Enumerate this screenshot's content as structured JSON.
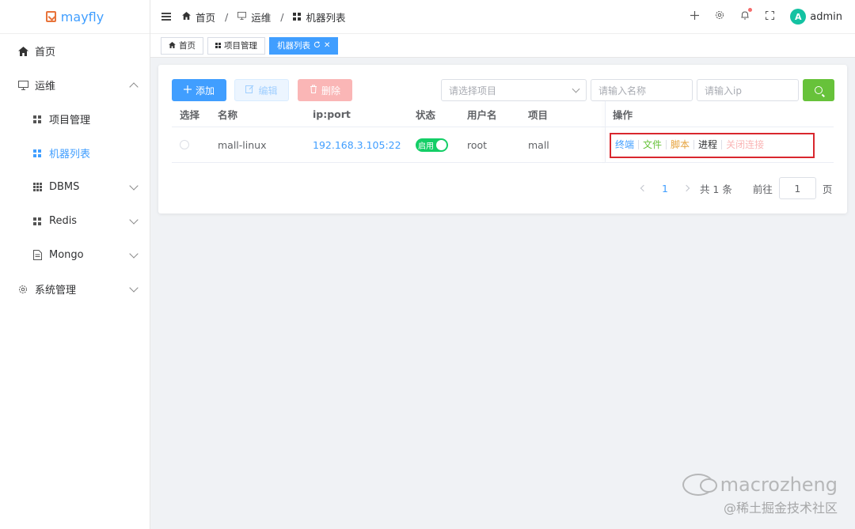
{
  "app": {
    "logo_text": "mayfly"
  },
  "sidebar": {
    "items": [
      {
        "label": "首页"
      },
      {
        "label": "运维"
      },
      {
        "label": "项目管理"
      },
      {
        "label": "机器列表"
      },
      {
        "label": "DBMS"
      },
      {
        "label": "Redis"
      },
      {
        "label": "Mongo"
      },
      {
        "label": "系统管理"
      }
    ]
  },
  "header": {
    "breadcrumb": [
      "首页",
      "运维",
      "机器列表"
    ],
    "separator": "/",
    "user_initial": "A",
    "user_name": "admin"
  },
  "tabs": [
    {
      "label": "首页"
    },
    {
      "label": "项目管理"
    },
    {
      "label": "机器列表"
    }
  ],
  "toolbar": {
    "add_label": "添加",
    "edit_label": "编辑",
    "delete_label": "删除",
    "project_placeholder": "请选择项目",
    "name_placeholder": "请输入名称",
    "ip_placeholder": "请输入ip"
  },
  "table": {
    "columns": [
      "选择",
      "名称",
      "ip:port",
      "状态",
      "用户名",
      "项目",
      "操作"
    ],
    "rows": [
      {
        "name": "mall-linux",
        "ip_port": "192.168.3.105:22",
        "status": "启用",
        "username": "root",
        "project": "mall",
        "actions": [
          "终端",
          "文件",
          "脚本",
          "进程",
          "关闭连接"
        ]
      }
    ]
  },
  "pagination": {
    "current_page": "1",
    "total": "共 1 条",
    "goto_label": "前往",
    "goto_value": "1",
    "page_unit": "页"
  },
  "watermark": {
    "line1": "macrozheng",
    "line2": "@稀土掘金技术社区"
  },
  "colors": {
    "primary": "#409eff",
    "success": "#67c23a",
    "warning": "#e6a23c",
    "danger_light": "#fab6b6",
    "switch_on": "#13ce66",
    "highlight_border": "#d9272e"
  }
}
